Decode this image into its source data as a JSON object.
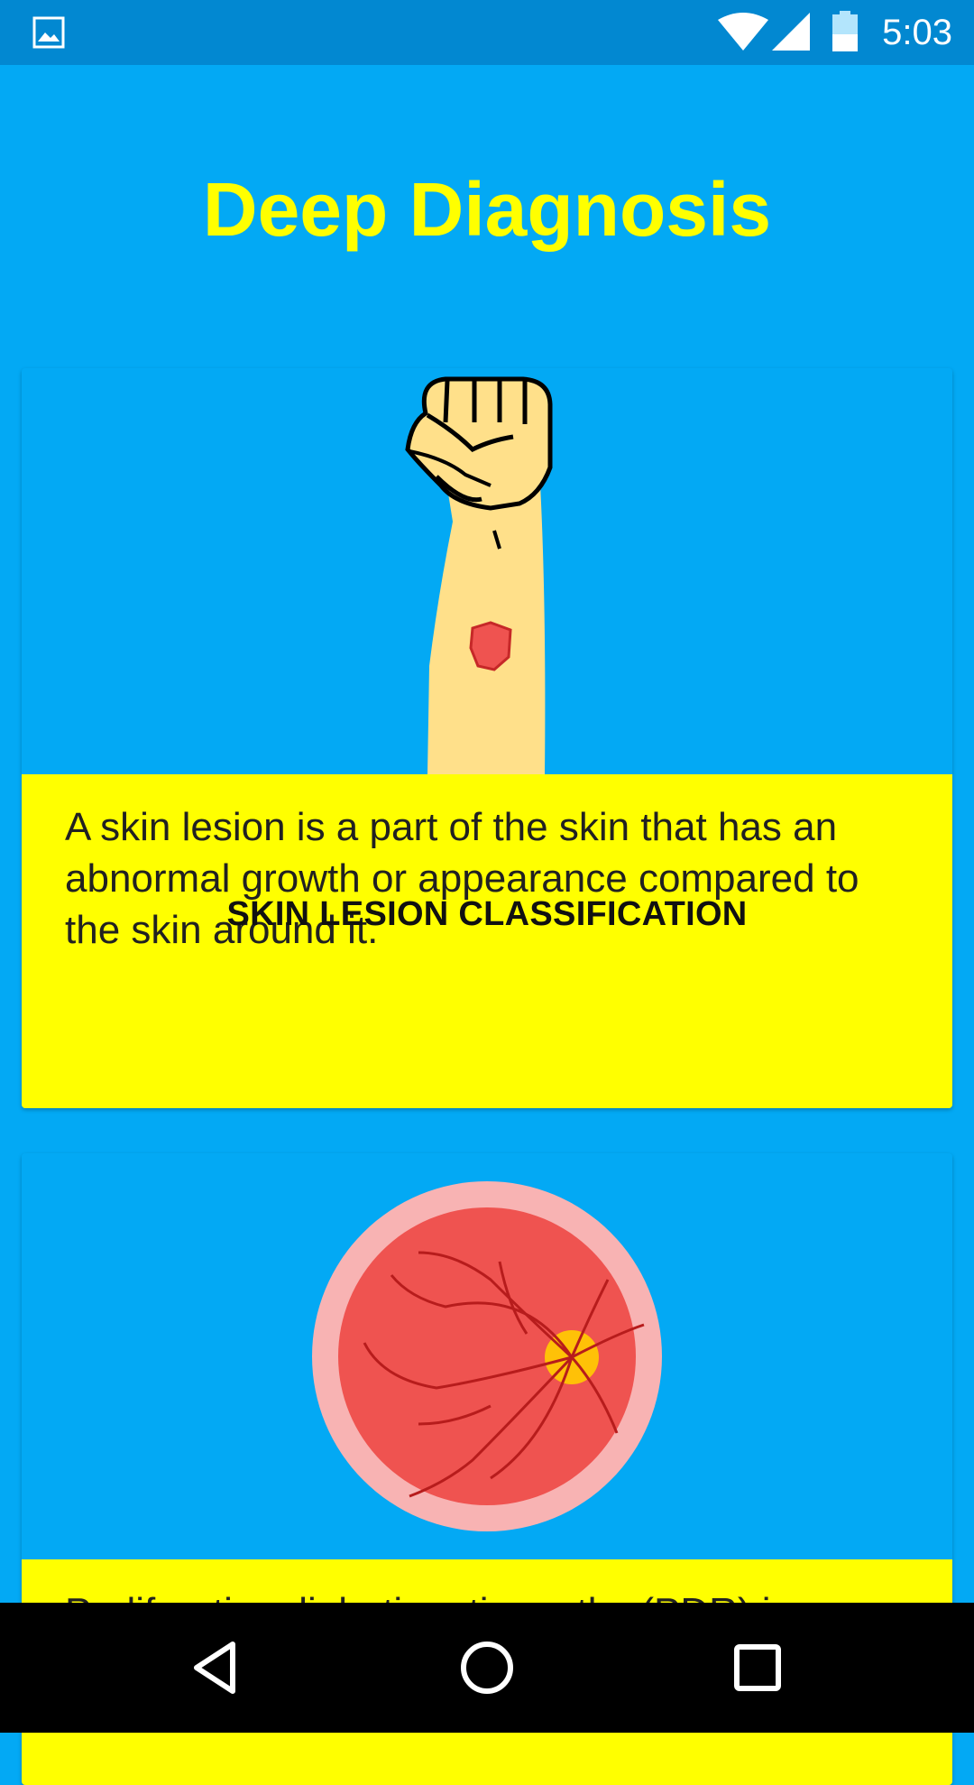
{
  "status_bar": {
    "time": "5:03",
    "icons": [
      "gallery-icon",
      "wifi-icon",
      "cell-signal-icon",
      "battery-icon"
    ]
  },
  "app": {
    "title": "Deep Diagnosis"
  },
  "cards": [
    {
      "id": "skin-lesion",
      "image_icon": "raised-fist-arm-with-lesion",
      "description": "A skin lesion is a part of the skin that has an abnormal growth or appearance compared to the skin around it.",
      "action_label": "SKIN LESION CLASSIFICATION"
    },
    {
      "id": "retina",
      "image_icon": "retina-fundus",
      "description": "Proliferative diabetic retinopathy (PDR) is"
    }
  ],
  "nav_bar": {
    "icons": [
      "back-icon",
      "home-icon",
      "recent-apps-icon"
    ]
  },
  "colors": {
    "background": "#03A9F4",
    "status_bar": "#0288D1",
    "title": "#FFFF00",
    "card_body": "#FFFF00",
    "nav_bar": "#000000"
  }
}
